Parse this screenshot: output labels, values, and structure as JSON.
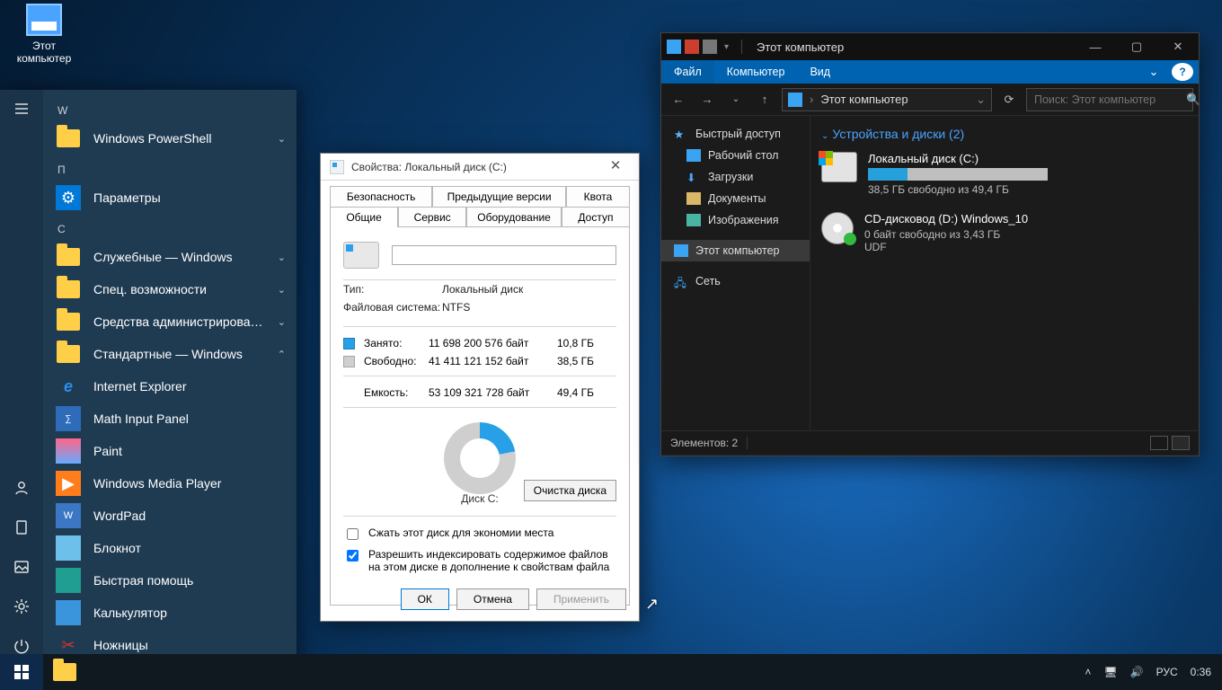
{
  "desktop": {
    "this_pc": "Этот\nкомпьютер"
  },
  "start": {
    "groups": {
      "w": "W",
      "p": "П",
      "s": "С"
    },
    "items": {
      "powershell": "Windows PowerShell",
      "parameters": "Параметры",
      "sluzhebnye": "Служебные — Windows",
      "spec": "Спец. возможности",
      "admin": "Средства администрирования...",
      "standard": "Стандартные — Windows",
      "ie": "Internet Explorer",
      "mathinput": "Math Input Panel",
      "paint": "Paint",
      "wmp": "Windows Media Player",
      "wordpad": "WordPad",
      "notepad": "Блокнот",
      "quickhelp": "Быстрая помощь",
      "calc": "Калькулятор",
      "scissors": "Ножницы"
    }
  },
  "props": {
    "title": "Свойства: Локальный диск (C:)",
    "tabs1": {
      "security": "Безопасность",
      "prev": "Предыдущие версии",
      "quota": "Квота"
    },
    "tabs2": {
      "general": "Общие",
      "service": "Сервис",
      "hardware": "Оборудование",
      "access": "Доступ"
    },
    "type_label": "Тип:",
    "type_value": "Локальный диск",
    "fs_label": "Файловая система:",
    "fs_value": "NTFS",
    "used_label": "Занято:",
    "used_bytes": "11 698 200 576 байт",
    "used_gb": "10,8 ГБ",
    "free_label": "Свободно:",
    "free_bytes": "41 411 121 152 байт",
    "free_gb": "38,5 ГБ",
    "capacity_label": "Емкость:",
    "capacity_bytes": "53 109 321 728 байт",
    "capacity_gb": "49,4 ГБ",
    "disk_c": "Диск C:",
    "cleanup": "Очистка диска",
    "compress": "Сжать этот диск для экономии места",
    "index": "Разрешить индексировать содержимое файлов на этом диске в дополнение к свойствам файла",
    "ok": "ОК",
    "cancel": "Отмена",
    "apply": "Применить"
  },
  "explorer": {
    "title": "Этот компьютер",
    "menu": {
      "file": "Файл",
      "computer": "Компьютер",
      "view": "Вид"
    },
    "breadcrumb": "Этот компьютер",
    "search_placeholder": "Поиск: Этот компьютер",
    "nav": {
      "quick": "Быстрый доступ",
      "desktop": "Рабочий стол",
      "downloads": "Загрузки",
      "documents": "Документы",
      "pictures": "Изображения",
      "thispc": "Этот компьютер",
      "network": "Сеть"
    },
    "group_header": "Устройства и диски (2)",
    "drives": {
      "c_name": "Локальный диск (C:)",
      "c_free": "38,5 ГБ свободно из 49,4 ГБ",
      "d_name": "CD-дисковод (D:) Windows_10",
      "d_line1": "0 байт свободно из 3,43 ГБ",
      "d_line2": "UDF"
    },
    "status": "Элементов: 2"
  },
  "taskbar": {
    "lang": "РУС",
    "time": "0:36"
  },
  "chart_data": {
    "type": "pie",
    "title": "Диск C:",
    "series": [
      {
        "name": "Занято",
        "value_bytes": 11698200576,
        "value_gb": 10.8,
        "color": "#28a0e8"
      },
      {
        "name": "Свободно",
        "value_bytes": 41411121152,
        "value_gb": 38.5,
        "color": "#cfcfcf"
      }
    ],
    "total_bytes": 53109321728,
    "total_gb": 49.4
  }
}
